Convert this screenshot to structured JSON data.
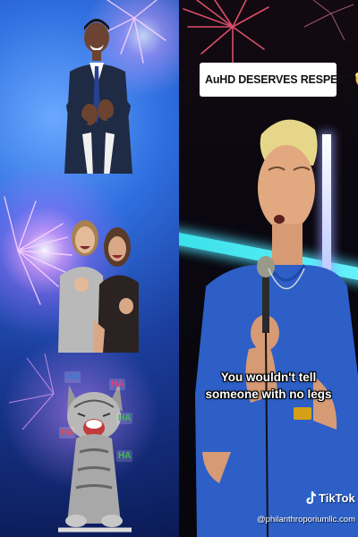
{
  "overlay": {
    "banner_text": "AuHD DESERVES RESPECT",
    "banner_emoji": "🫡",
    "caption_line1": "You wouldn't tell",
    "caption_line2": "someone with no legs"
  },
  "watermark": {
    "brand": "TikTok",
    "handle": "@philanthroporiumllc.com"
  },
  "stickers": {
    "ha_label": "HA"
  },
  "colors": {
    "neon_cyan": "#38e0e8",
    "left_bg": "#2f6fe0",
    "shirt_blue": "#2d5fc7"
  }
}
